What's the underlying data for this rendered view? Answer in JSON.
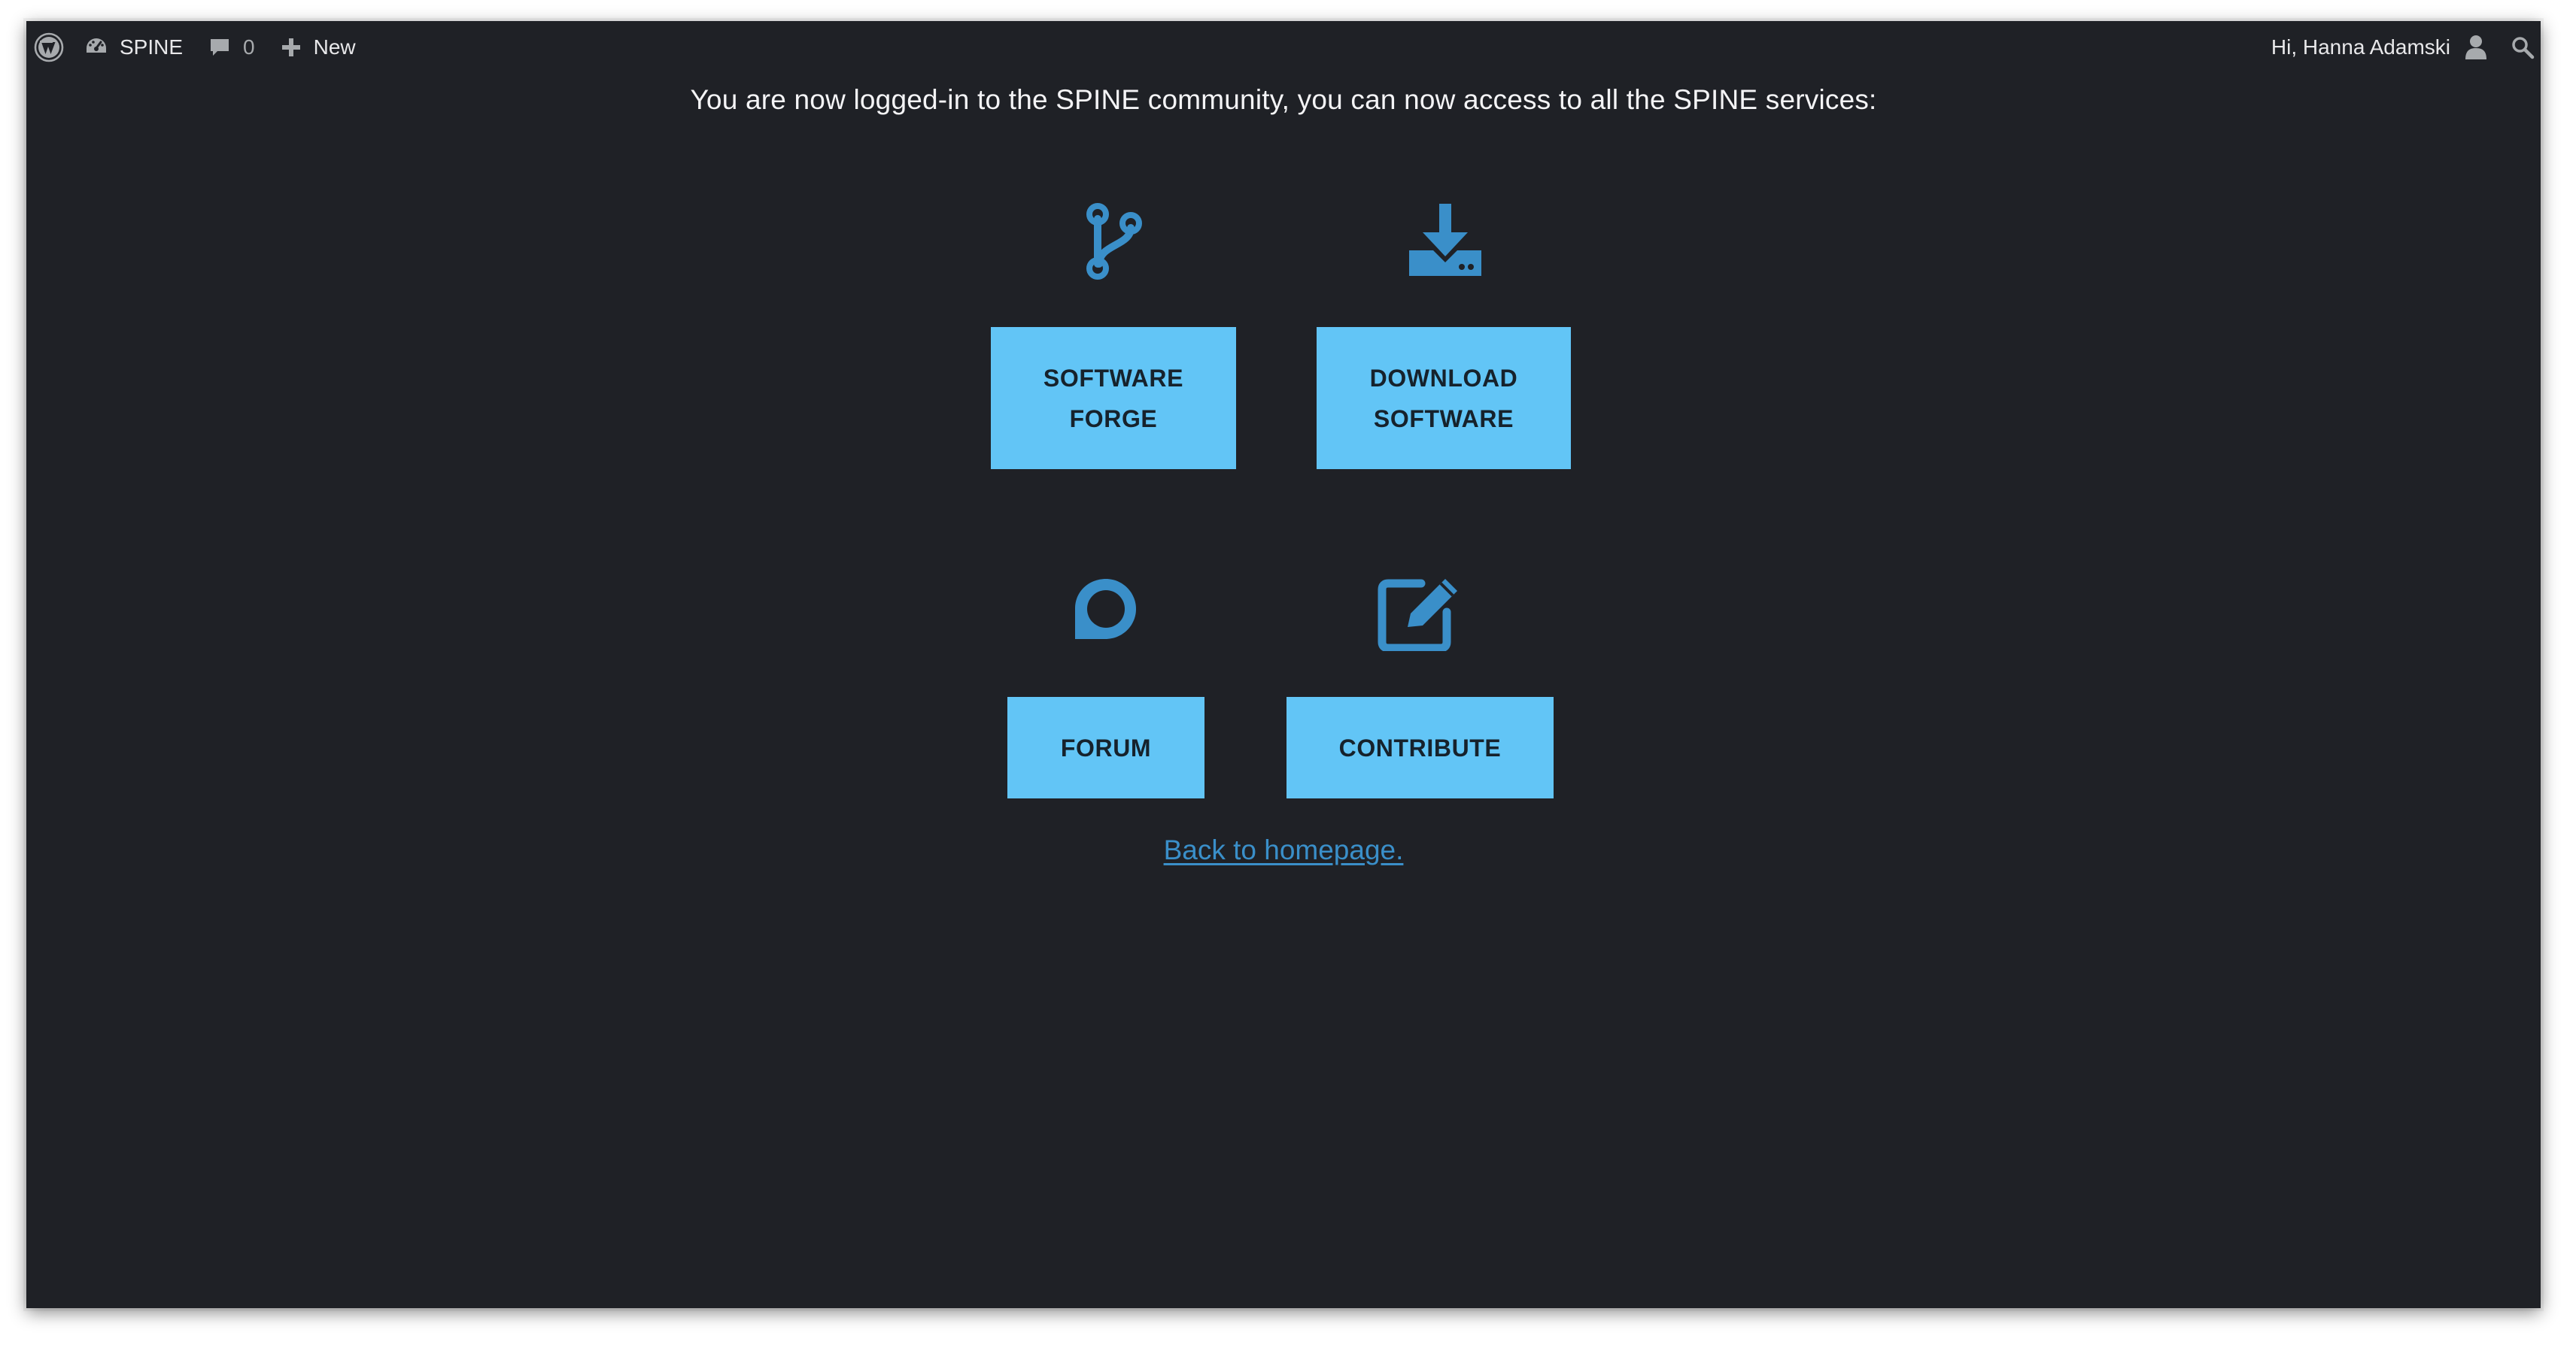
{
  "adminbar": {
    "site_name": "SPINE",
    "comment_count": "0",
    "new_label": "New",
    "greeting": "Hi, Hanna Adamski"
  },
  "main": {
    "intro": "You are now logged-in to the SPINE community, you can now access to all the SPINE services:",
    "services": {
      "software_forge": {
        "line1": "SOFTWARE",
        "line2": "FORGE",
        "icon": "code-branch-icon"
      },
      "download_software": {
        "line1": "DOWNLOAD",
        "line2": "SOFTWARE",
        "icon": "download-icon"
      },
      "forum": {
        "label": "FORUM",
        "icon": "chat-bubble-icon"
      },
      "contribute": {
        "label": "CONTRIBUTE",
        "icon": "edit-icon"
      }
    },
    "back_link": "Back to homepage."
  },
  "colors": {
    "background": "#1f2126",
    "button": "#62c5f6",
    "icon_accent": "#3a8fc9",
    "text": "#f4f4f6"
  }
}
